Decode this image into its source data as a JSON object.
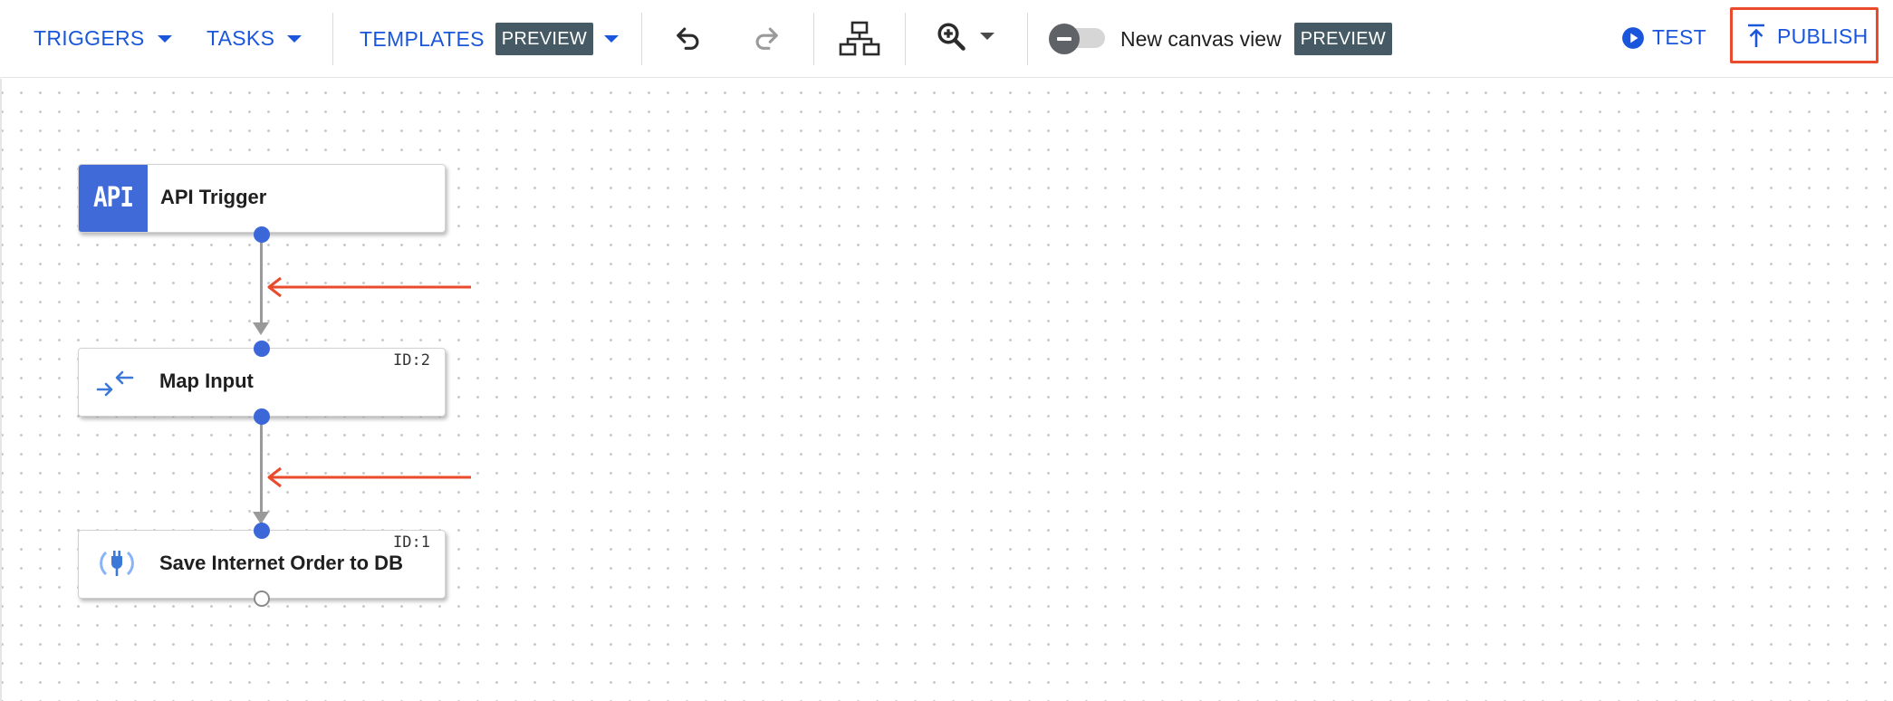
{
  "toolbar": {
    "triggers_label": "TRIGGERS",
    "tasks_label": "TASKS",
    "templates_label": "TEMPLATES",
    "templates_badge": "PREVIEW",
    "new_canvas_label": "New canvas view",
    "new_canvas_badge": "PREVIEW",
    "new_canvas_enabled": false,
    "test_label": "TEST",
    "publish_label": "PUBLISH",
    "icons": [
      "undo-icon",
      "redo-icon",
      "auto-layout-icon",
      "zoom-in-icon",
      "play-circle-icon",
      "publish-icon"
    ]
  },
  "colors": {
    "accent": "#1a56db",
    "badge_bg": "#455a64",
    "highlight": "#e94b2c",
    "node_port": "#3b67d9",
    "api_block": "#3f6ad8"
  },
  "canvas": {
    "nodes": [
      {
        "name": "api-trigger",
        "label": "API Trigger",
        "id_label": "",
        "icon": "api-badge-icon"
      },
      {
        "name": "map-input",
        "label": "Map Input",
        "id_label": "ID:2",
        "icon": "data-mapping-icon"
      },
      {
        "name": "save-order",
        "label": "Save Internet Order to DB",
        "id_label": "ID:1",
        "icon": "connector-icon"
      }
    ],
    "api_badge_text": "API"
  }
}
